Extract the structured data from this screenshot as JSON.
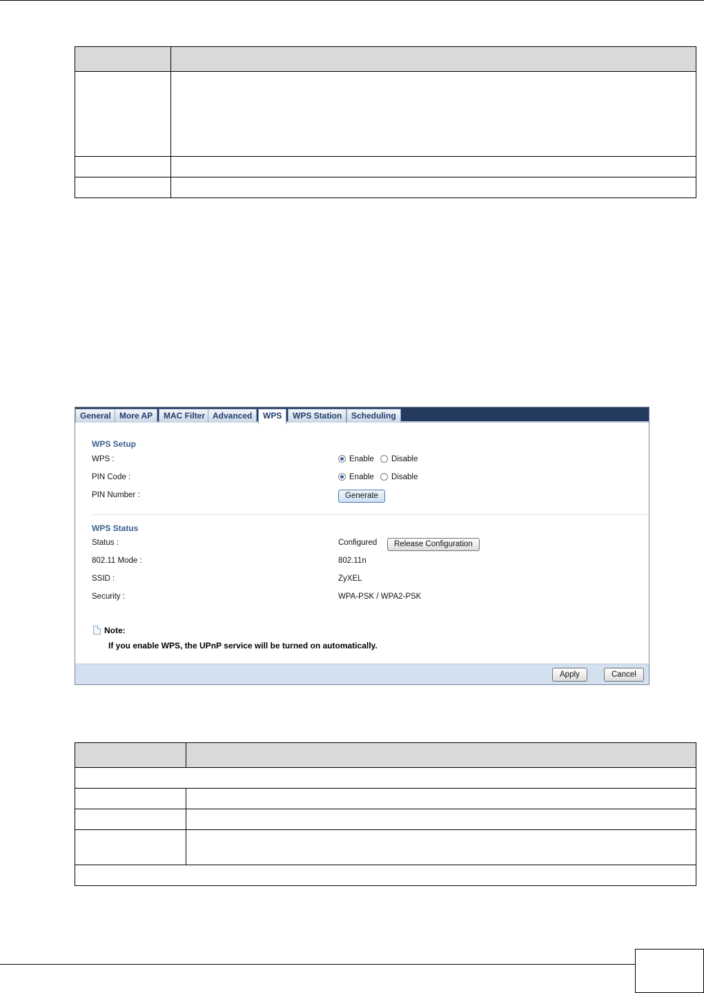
{
  "panel": {
    "tabs": [
      "General",
      "More AP",
      "MAC Filter",
      "Advanced",
      "WPS",
      "WPS Station",
      "Scheduling"
    ],
    "active_tab": "WPS",
    "setup": {
      "title": "WPS Setup",
      "wps_label": "WPS :",
      "pin_code_label": "PIN Code :",
      "pin_number_label": "PIN Number :",
      "enable": "Enable",
      "disable": "Disable",
      "generate_button": "Generate"
    },
    "status": {
      "title": "WPS Status",
      "status_label": "Status :",
      "status_value": "Configured",
      "release_button": "Release Configuration",
      "mode_label": "802.11 Mode :",
      "mode_value": "802.11n",
      "ssid_label": "SSID :",
      "ssid_value": "ZyXEL",
      "security_label": "Security :",
      "security_value": "WPA-PSK / WPA2-PSK"
    },
    "note": {
      "title": "Note:",
      "text": "If you enable WPS, the UPnP service will be turned on automatically."
    },
    "footer": {
      "apply": "Apply",
      "cancel": "Cancel"
    }
  },
  "colors": {
    "tab_bar": "#243a5e",
    "section_title": "#3a5f8f",
    "footer_bg": "#d3e0ef",
    "table_header": "#d9d9d9"
  }
}
